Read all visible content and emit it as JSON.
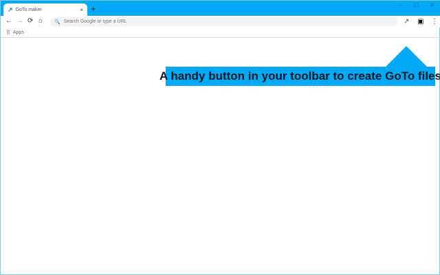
{
  "browser": {
    "tab_title": "GoTo maker",
    "tab_close": "×",
    "new_tab": "+",
    "window_controls": {
      "minimize": "–",
      "maximize": "☐",
      "close": "✕"
    },
    "nav": {
      "back": "←",
      "forward": "→",
      "reload": "⟳",
      "home": "⌂"
    },
    "omnibox_placeholder": "Search Google or type a URL",
    "search_glyph": "🔍",
    "bookmarks": {
      "apps_glyph": "⠿",
      "apps_label": "Apps"
    },
    "extension_glyph": "↗",
    "profile_glyph": "▣",
    "menu_glyph": "⋮"
  },
  "callout": {
    "text": "A handy button in your toolbar to create GoTo files",
    "color": "#03a9f4"
  }
}
